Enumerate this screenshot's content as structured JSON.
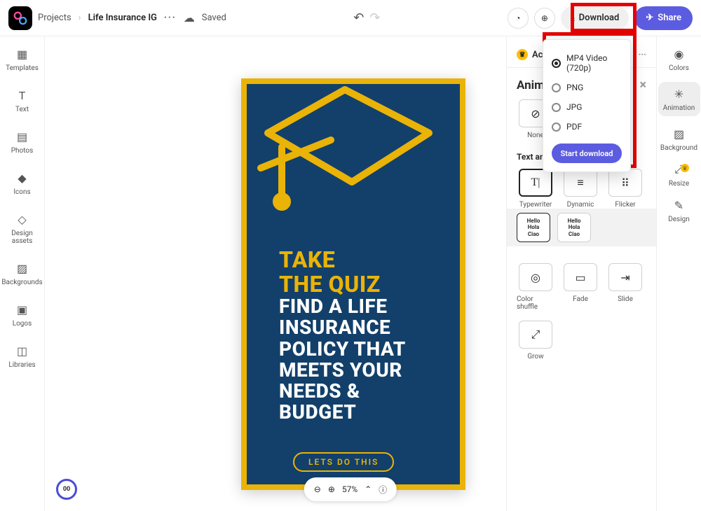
{
  "breadcrumb": {
    "root": "Projects",
    "file": "Life Insurance IG",
    "status": "Saved"
  },
  "topbar": {
    "download": "Download",
    "share": "Share"
  },
  "leftnav": [
    "Templates",
    "Text",
    "Photos",
    "Icons",
    "Design assets",
    "Backgrounds",
    "Logos",
    "Libraries"
  ],
  "rightnav": [
    "Colors",
    "Animation",
    "Background",
    "Resize",
    "Design"
  ],
  "panel": {
    "tab": "Ac",
    "title": "Anim",
    "none": "None",
    "section": "Text animation",
    "typewriter": "Typewriter",
    "dynamic": "Dynamic",
    "flicker": "Flicker",
    "hello": [
      "Hello",
      "Hola",
      "Ciao"
    ],
    "colorshuffle": "Color shuffle",
    "fade": "Fade",
    "slide": "Slide",
    "grow": "Grow"
  },
  "zoom": {
    "pct": "57%"
  },
  "timer": "00",
  "art": {
    "line1": "TAKE",
    "line2": "THE QUIZ",
    "body": "FIND A LIFE\nINSURANCE\nPOLICY THAT\nMEETS YOUR\nNEEDS &\nBUDGET",
    "cta": "LETS DO THIS"
  },
  "download_popup": {
    "options": [
      "MP4 Video (720p)",
      "PNG",
      "JPG",
      "PDF"
    ],
    "selected": 0,
    "start": "Start download"
  }
}
